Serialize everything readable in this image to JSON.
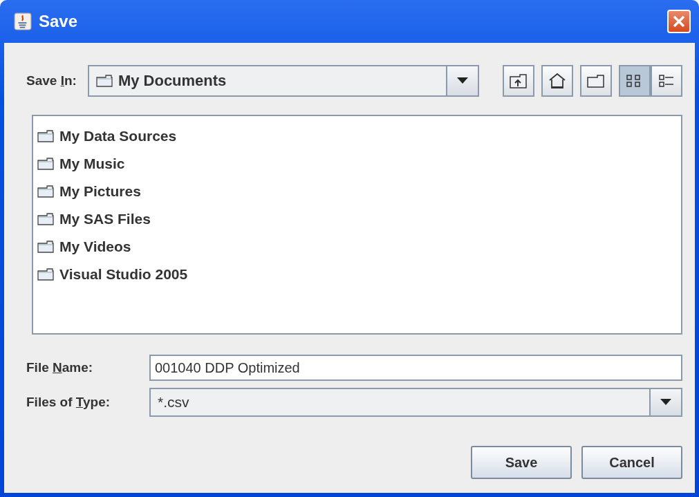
{
  "window": {
    "title": "Save"
  },
  "save_in": {
    "label_parts": [
      "Save ",
      "I",
      "n:"
    ],
    "value": "My Documents"
  },
  "toolbar": [
    {
      "kind": "up",
      "selected": false
    },
    {
      "kind": "home",
      "selected": false
    },
    {
      "kind": "new-folder",
      "selected": false
    },
    {
      "kind": "list-view",
      "selected": true
    },
    {
      "kind": "details-view",
      "selected": false
    }
  ],
  "files": [
    {
      "name": "My Data Sources"
    },
    {
      "name": "My Music"
    },
    {
      "name": "My Pictures"
    },
    {
      "name": "My SAS Files"
    },
    {
      "name": "My Videos"
    },
    {
      "name": "Visual Studio 2005"
    }
  ],
  "file_name": {
    "label_parts": [
      "File ",
      "N",
      "ame:"
    ],
    "value": "001040 DDP Optimized"
  },
  "file_type": {
    "label_parts": [
      "Files of ",
      "T",
      "ype:"
    ],
    "value": "*.csv"
  },
  "buttons": [
    "Save",
    "Cancel"
  ]
}
